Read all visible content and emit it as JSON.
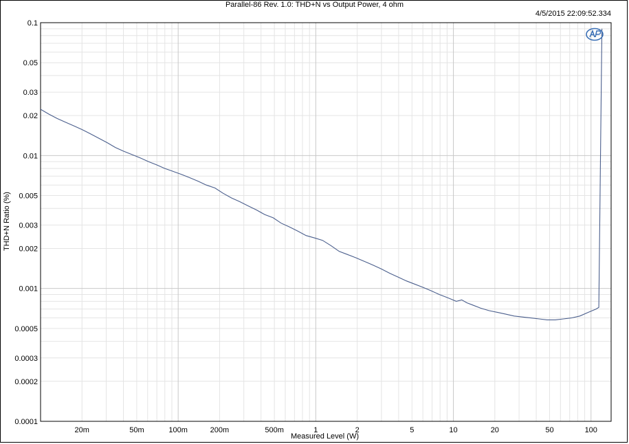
{
  "chart_data": {
    "type": "line",
    "title": "Parallel-86 Rev. 1.0: THD+N vs Output Power, 4 ohm",
    "timestamp": "4/5/2015 22:09:52.334",
    "xlabel": "Measured Level (W)",
    "ylabel": "THD+N Ratio (%)",
    "x_scale": "log",
    "y_scale": "log",
    "xlim": [
      0.01,
      140
    ],
    "ylim": [
      0.0001,
      0.1
    ],
    "grid": true,
    "line_color": "#4a5e8c",
    "x_ticks": [
      {
        "value": 0.02,
        "label": "20m"
      },
      {
        "value": 0.05,
        "label": "50m"
      },
      {
        "value": 0.1,
        "label": "100m"
      },
      {
        "value": 0.2,
        "label": "200m"
      },
      {
        "value": 0.5,
        "label": "500m"
      },
      {
        "value": 1,
        "label": "1"
      },
      {
        "value": 2,
        "label": "2"
      },
      {
        "value": 5,
        "label": "5"
      },
      {
        "value": 10,
        "label": "10"
      },
      {
        "value": 20,
        "label": "20"
      },
      {
        "value": 50,
        "label": "50"
      },
      {
        "value": 100,
        "label": "100"
      }
    ],
    "y_ticks": [
      {
        "value": 0.1,
        "label": "0.1"
      },
      {
        "value": 0.05,
        "label": "0.05"
      },
      {
        "value": 0.03,
        "label": "0.03"
      },
      {
        "value": 0.02,
        "label": "0.02"
      },
      {
        "value": 0.01,
        "label": "0.01"
      },
      {
        "value": 0.005,
        "label": "0.005"
      },
      {
        "value": 0.003,
        "label": "0.003"
      },
      {
        "value": 0.002,
        "label": "0.002"
      },
      {
        "value": 0.001,
        "label": "0.001"
      },
      {
        "value": 0.0005,
        "label": "0.0005"
      },
      {
        "value": 0.0003,
        "label": "0.0003"
      },
      {
        "value": 0.0002,
        "label": "0.0002"
      },
      {
        "value": 0.0001,
        "label": "0.0001"
      }
    ],
    "series": [
      {
        "x": [
          0.01,
          0.0115,
          0.0132,
          0.0152,
          0.0175,
          0.02,
          0.023,
          0.0265,
          0.0305,
          0.035,
          0.04,
          0.046,
          0.053,
          0.061,
          0.07,
          0.08,
          0.092,
          0.106,
          0.122,
          0.14,
          0.16,
          0.185,
          0.212,
          0.244,
          0.28,
          0.32,
          0.37,
          0.425,
          0.49,
          0.56,
          0.645,
          0.74,
          0.85,
          0.98,
          1.12,
          1.29,
          1.48,
          1.7,
          1.96,
          2.25,
          2.6,
          3.0,
          3.45,
          3.95,
          4.55,
          5.2,
          6.0,
          6.9,
          7.9,
          9.1,
          10.5,
          11.5,
          12.5,
          13.8,
          15.8,
          18.2,
          21,
          24,
          27.6,
          31.7,
          36.5,
          42,
          48,
          55,
          63,
          72,
          83,
          95,
          109,
          114,
          120
        ],
        "y": [
          0.0223,
          0.0205,
          0.019,
          0.0178,
          0.0167,
          0.0157,
          0.0146,
          0.0135,
          0.0125,
          0.0115,
          0.0108,
          0.0102,
          0.0096,
          0.009,
          0.0085,
          0.008,
          0.0076,
          0.0072,
          0.0068,
          0.0064,
          0.006,
          0.0057,
          0.0052,
          0.0048,
          0.0045,
          0.0042,
          0.0039,
          0.0036,
          0.0034,
          0.0031,
          0.0029,
          0.0027,
          0.0025,
          0.0024,
          0.0023,
          0.0021,
          0.0019,
          0.0018,
          0.0017,
          0.0016,
          0.0015,
          0.0014,
          0.0013,
          0.00122,
          0.00114,
          0.00108,
          0.00102,
          0.00096,
          0.0009,
          0.00085,
          0.0008,
          0.00082,
          0.00078,
          0.00075,
          0.00071,
          0.00068,
          0.00066,
          0.00064,
          0.00062,
          0.00061,
          0.0006,
          0.00059,
          0.00058,
          0.00058,
          0.00059,
          0.0006,
          0.00062,
          0.00066,
          0.0007,
          0.00072,
          0.09
        ]
      }
    ]
  }
}
